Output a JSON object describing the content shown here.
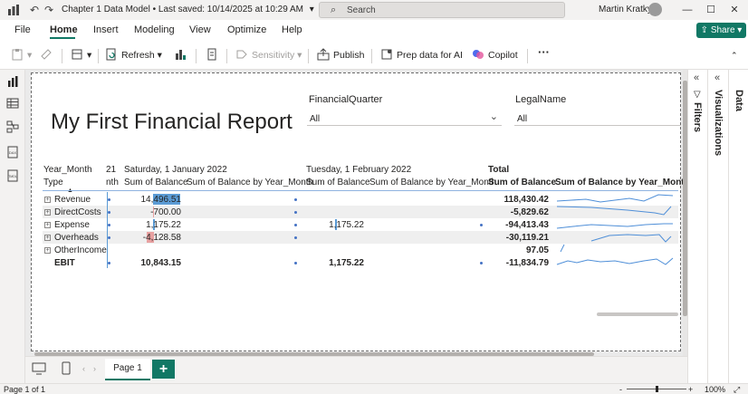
{
  "titlebar": {
    "document": "Chapter 1 Data Model • Last saved: 10/14/2025 at 10:29 AM",
    "dropdown_caret": "▾",
    "search_placeholder": "Search",
    "user": "Martin Kratky",
    "icons": [
      "save-icon",
      "undo-icon",
      "redo-icon",
      "minimize-icon",
      "maximize-icon",
      "close-icon"
    ]
  },
  "menu": {
    "tabs": [
      "File",
      "Home",
      "Insert",
      "Modeling",
      "View",
      "Optimize",
      "Help"
    ],
    "active": "Home",
    "share": "Share"
  },
  "ribbon": {
    "refresh": "Refresh",
    "sensitivity": "Sensitivity",
    "publish": "Publish",
    "prep_data": "Prep data for AI",
    "copilot": "Copilot",
    "more": "···"
  },
  "report": {
    "title": "My First Financial Report",
    "slicers": [
      {
        "label": "FinancialQuarter",
        "value": "All"
      },
      {
        "label": "LegalName",
        "value": "All"
      }
    ]
  },
  "matrix": {
    "col_group_header": "Year_Month",
    "row_header": "Type",
    "partial_col": "21",
    "partial_sub": "nth",
    "groups": [
      {
        "label": "Saturday, 1 January 2022",
        "sub1": "Sum of Balance",
        "sub2": "Sum of Balance by Year_Month"
      },
      {
        "label": "Tuesday, 1 February 2022",
        "sub1": "Sum of Balance",
        "sub2": "Sum of Balance by Year_Month"
      },
      {
        "label": "Total",
        "sub1": "Sum of Balance",
        "sub2": "Sum of Balance by Year_Month"
      }
    ],
    "rows": [
      {
        "type": "Revenue",
        "jan": "14,496.51",
        "feb": "",
        "total": "118,430.42"
      },
      {
        "type": "DirectCosts",
        "jan": "-700.00",
        "feb": "",
        "total": "-5,829.62"
      },
      {
        "type": "Expense",
        "jan": "1,175.22",
        "feb": "1,175.22",
        "total": "-94,413.43"
      },
      {
        "type": "Overheads",
        "jan": "-4,128.58",
        "feb": "",
        "total": "-30,119.21"
      },
      {
        "type": "OtherIncome",
        "jan": "",
        "feb": "",
        "total": "97.05"
      }
    ],
    "total_row": {
      "type": "EBIT",
      "jan": "10,843.15",
      "feb": "1,175.22",
      "total": "-11,834.79"
    },
    "sparkline_color": "#4f8fd8"
  },
  "panes": {
    "filters": "Filters",
    "visualizations": "Visualizations",
    "data": "Data"
  },
  "pages": {
    "tabs": [
      "Page 1"
    ],
    "add": "+"
  },
  "status": {
    "page": "Page 1 of 1",
    "zoom": "100%",
    "zoom_minus": "-",
    "zoom_plus": "+"
  },
  "colors": {
    "accent": "#117865",
    "databar_positive": "#5b9bd5",
    "databar_negative": "#e8a1a1"
  }
}
